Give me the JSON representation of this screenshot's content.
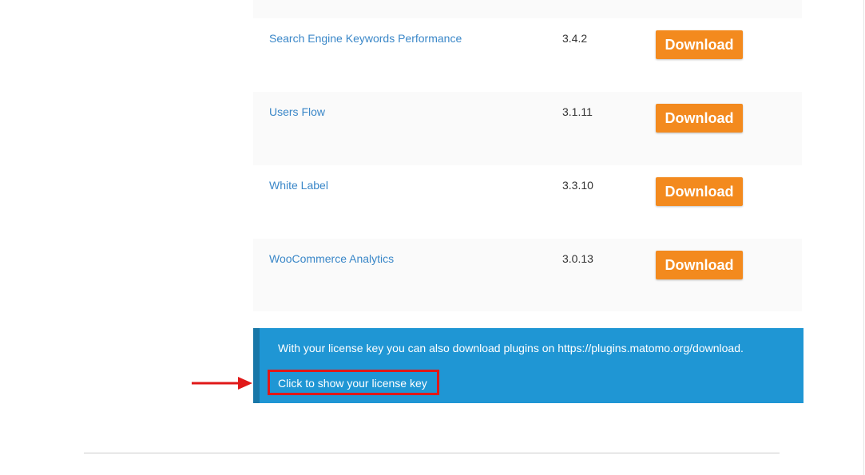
{
  "plugins": [
    {
      "name": "Search Engine Keywords Performance",
      "version": "3.4.2",
      "button": "Download"
    },
    {
      "name": "Users Flow",
      "version": "3.1.11",
      "button": "Download"
    },
    {
      "name": "White Label",
      "version": "3.3.10",
      "button": "Download"
    },
    {
      "name": "WooCommerce Analytics",
      "version": "3.0.13",
      "button": "Download"
    }
  ],
  "notice": {
    "text": "With your license key you can also download plugins on https://plugins.matomo.org/download.",
    "link": "Click to show your license key"
  },
  "colors": {
    "link": "#3a87c8",
    "button": "#f38a1e",
    "notice_bg": "#1f96d4",
    "highlight": "#e01818"
  }
}
